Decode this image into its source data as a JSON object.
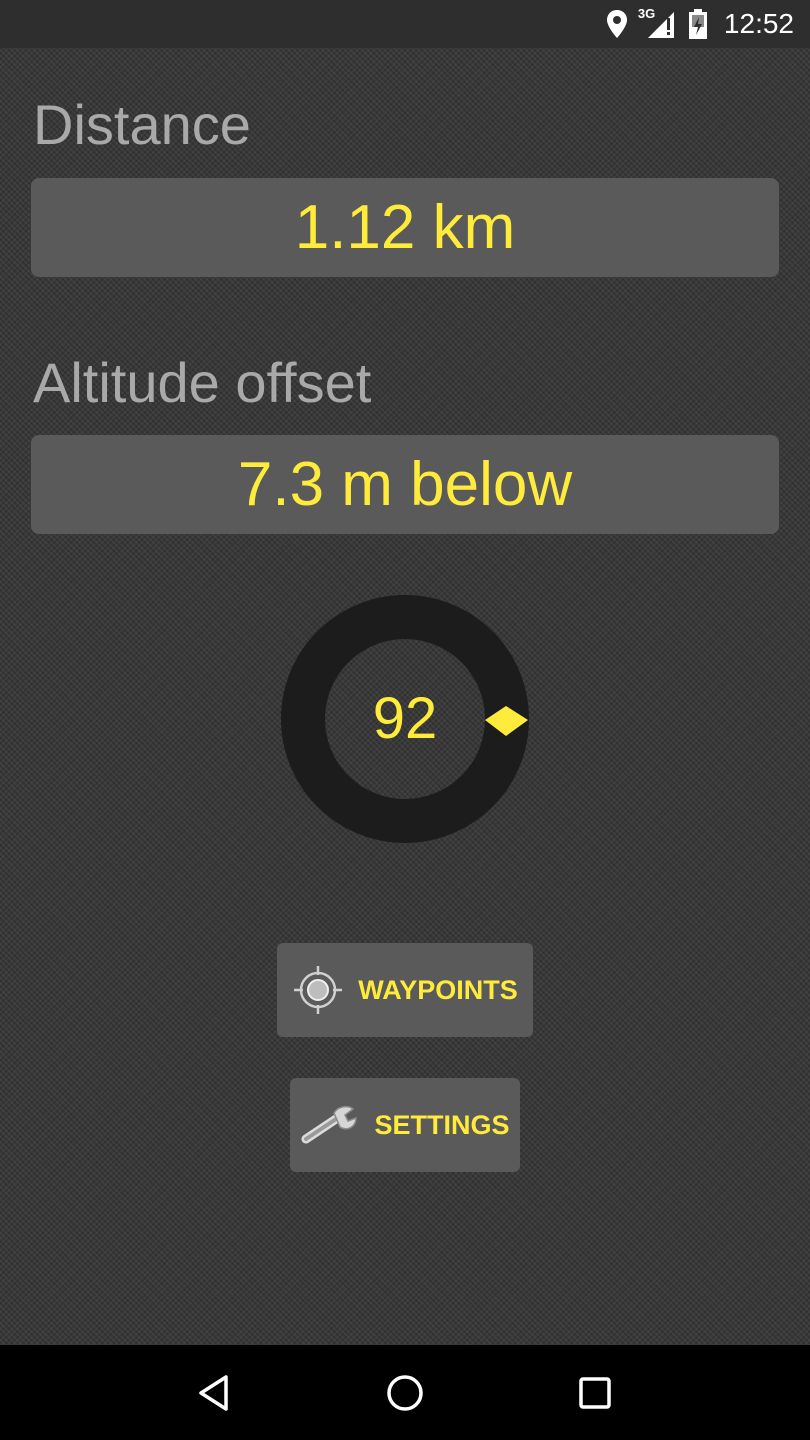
{
  "status_bar": {
    "network_label": "3G",
    "time": "12:52",
    "icons": [
      "location-pin-icon",
      "signal-3g-icon",
      "battery-icon"
    ]
  },
  "distance": {
    "label": "Distance",
    "value": "1.12 km"
  },
  "altitude": {
    "label": "Altitude offset",
    "value": "7.3 m below"
  },
  "compass": {
    "value": "92",
    "ring_color": "#1c1c1c",
    "pointer_color": "#ffeb3b"
  },
  "buttons": {
    "waypoints_label": "WAYPOINTS",
    "settings_label": "SETTINGS"
  },
  "nav_bar": {
    "icons": [
      "back-icon",
      "home-icon",
      "recents-icon"
    ]
  },
  "colors": {
    "accent": "#ffeb3b",
    "label_gray": "#a9a9a9",
    "box_bg": "#5a5a5a",
    "background": "#3a3a3a"
  }
}
